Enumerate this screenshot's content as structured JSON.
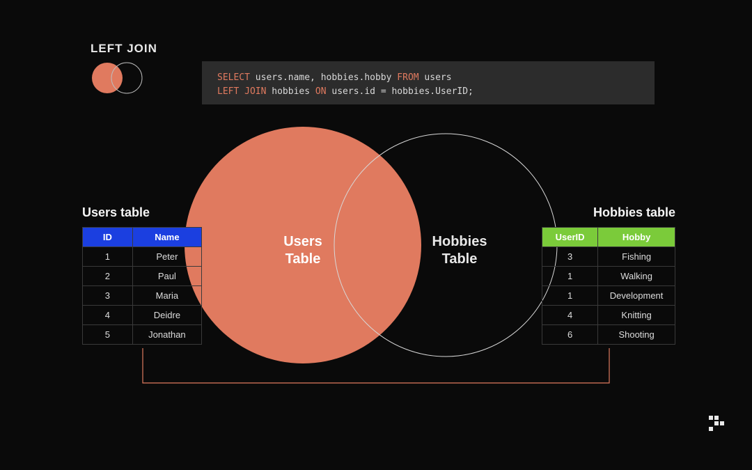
{
  "title": "LEFT JOIN",
  "sql": {
    "line1": {
      "select": "SELECT",
      "cols": " users.name, hobbies.hobby ",
      "from": "FROM",
      "tbl": " users"
    },
    "line2": {
      "left_join": "LEFT JOIN",
      "mid": " hobbies ",
      "on": "ON",
      "cond": " users.id = hobbies.UserID;"
    }
  },
  "venn": {
    "left_label_1": "Users",
    "left_label_2": "Table",
    "right_label_1": "Hobbies",
    "right_label_2": "Table"
  },
  "users_table": {
    "title": "Users table",
    "headers": [
      "ID",
      "Name"
    ],
    "rows": [
      [
        "1",
        "Peter"
      ],
      [
        "2",
        "Paul"
      ],
      [
        "3",
        "Maria"
      ],
      [
        "4",
        "Deidre"
      ],
      [
        "5",
        "Jonathan"
      ]
    ]
  },
  "hobbies_table": {
    "title": "Hobbies table",
    "headers": [
      "UserID",
      "Hobby"
    ],
    "rows": [
      [
        "3",
        "Fishing"
      ],
      [
        "1",
        "Walking"
      ],
      [
        "1",
        "Development"
      ],
      [
        "4",
        "Knitting"
      ],
      [
        "6",
        "Shooting"
      ]
    ]
  },
  "colors": {
    "accent": "#e07a5f",
    "blue": "#1b3fe0",
    "green": "#7bcb3a",
    "codebg": "#2c2c2c",
    "bg": "#0a0a0a"
  }
}
